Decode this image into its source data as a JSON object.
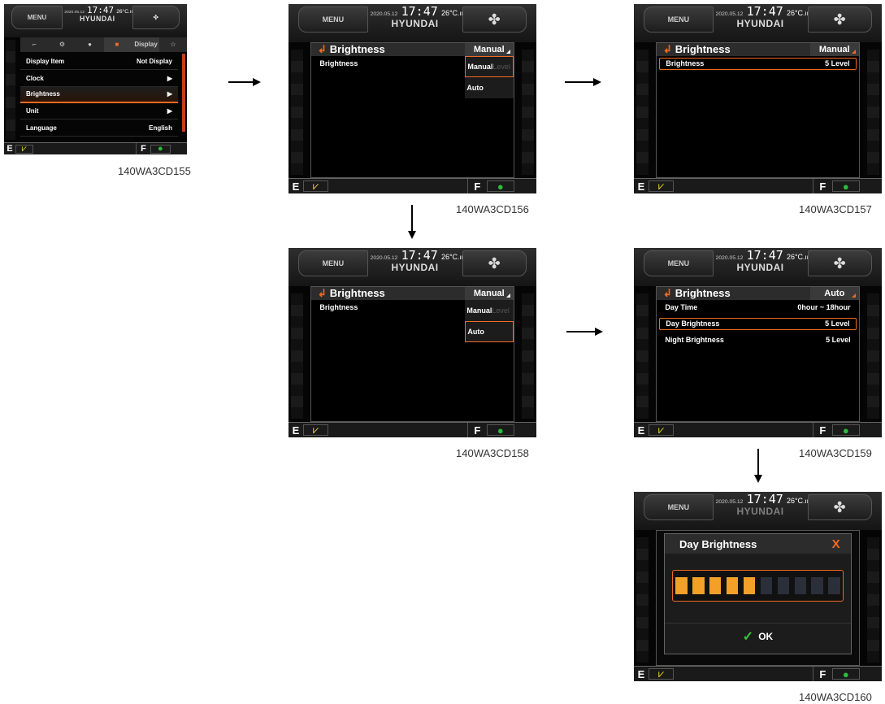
{
  "header": {
    "menu": "MENU",
    "date": "2020.05.12",
    "time": "17:47",
    "temp": "26°C",
    "signal": ".ııl",
    "brand": "HYUNDAI",
    "fan_icon": "fan-icon"
  },
  "footer": {
    "e": "E",
    "f": "F",
    "green_icon": "boom-icon",
    "turtle_icon": "turtle-icon"
  },
  "panel_a": {
    "tab_label": "Display",
    "items": [
      {
        "label": "Display Item",
        "value": "Not Display"
      },
      {
        "label": "Clock",
        "value": "▶"
      },
      {
        "label": "Brightness",
        "value": "▶"
      },
      {
        "label": "Unit",
        "value": "▶"
      },
      {
        "label": "Language",
        "value": "English"
      }
    ],
    "caption": "140WA3CD155"
  },
  "panel_b": {
    "title": "Brightness",
    "mode": "Manual",
    "row_label": "Brightness",
    "options": [
      "Manual",
      "Auto"
    ],
    "hidden_text": "Level",
    "caption": "140WA3CD156"
  },
  "panel_c": {
    "title": "Brightness",
    "mode": "Manual",
    "row_label": "Brightness",
    "row_value": "5 Level",
    "caption": "140WA3CD157"
  },
  "panel_d": {
    "title": "Brightness",
    "mode": "Manual",
    "row_label": "Brightness",
    "options": [
      "Manual",
      "Auto"
    ],
    "hidden_text": "Level",
    "caption": "140WA3CD158"
  },
  "panel_e": {
    "title": "Brightness",
    "mode": "Auto",
    "rows": [
      {
        "label": "Day Time",
        "value": "0hour ~ 18hour"
      },
      {
        "label": "Day Brightness",
        "value": "5 Level"
      },
      {
        "label": "Night Brightness",
        "value": "5 Level"
      }
    ],
    "caption": "140WA3CD159"
  },
  "panel_f": {
    "popup_title": "Day Brightness",
    "close": "X",
    "level": 5,
    "level_max": 10,
    "ok": "OK",
    "caption": "140WA3CD160"
  },
  "colors": {
    "accent": "#f06a20",
    "level_on": "#f2a028",
    "ok_check": "#3ec23e"
  }
}
